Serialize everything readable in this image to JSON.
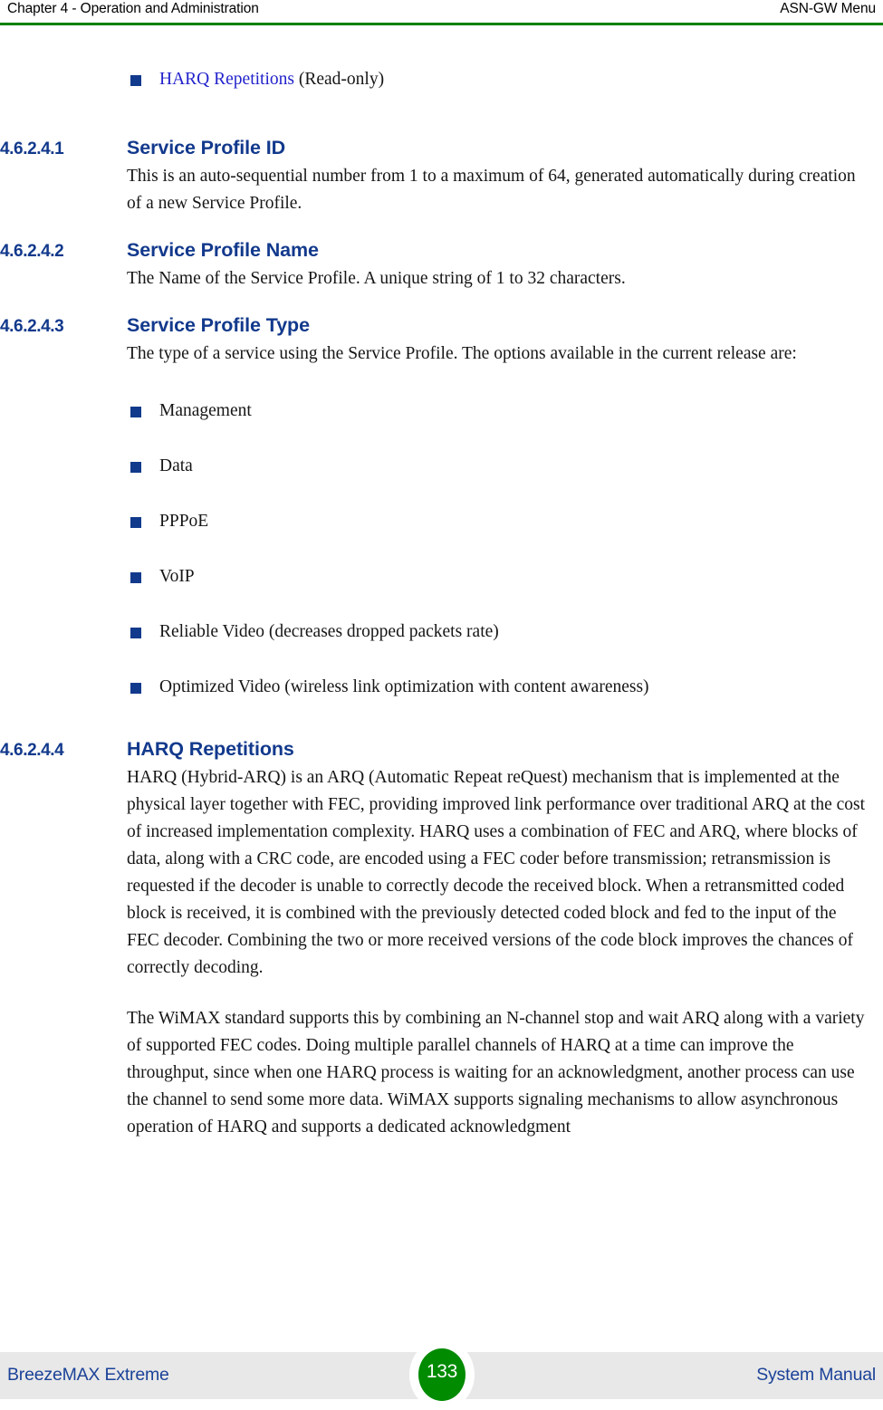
{
  "header": {
    "left": "Chapter 4 - Operation and Administration",
    "right": "ASN-GW Menu",
    "rule_color": "#008000"
  },
  "colors": {
    "heading_blue": "#12398c",
    "bullet_square": "#123a8c",
    "link_blue": "#2222cc",
    "footer_band": "#e8e8e8",
    "footer_text": "#1b4298",
    "badge_green": "#008b00"
  },
  "top_bullet": {
    "link_text": "HARQ Repetitions",
    "suffix_text": " (Read-only)"
  },
  "sections": [
    {
      "number": "4.6.2.4.1",
      "title": "Service Profile ID",
      "body": "This is an auto-sequential number from 1 to a maximum of 64, generated automatically during creation of a new Service Profile."
    },
    {
      "number": "4.6.2.4.2",
      "title": "Service Profile Name",
      "body": "The Name of the Service Profile. A unique string of 1 to 32 characters."
    },
    {
      "number": "4.6.2.4.3",
      "title": "Service Profile Type",
      "body": "The type of a service using the Service Profile. The options available in the current release are:"
    },
    {
      "number": "4.6.2.4.4",
      "title": "HARQ Repetitions",
      "body": "HARQ (Hybrid-ARQ) is an ARQ (Automatic Repeat reQuest) mechanism that is implemented at the physical layer together with FEC, providing improved link performance over traditional ARQ at the cost of increased implementation complexity. HARQ uses a combination of FEC and ARQ, where blocks of data, along with a CRC code, are encoded using a FEC coder before transmission; retransmission is requested if the decoder is unable to correctly decode the received block. When a retransmitted coded block is received, it is combined with the previously detected coded block and fed to the input of the FEC decoder. Combining the two or more received versions of the code block improves the chances of correctly decoding.",
      "body2": "The WiMAX standard supports this by combining an N-channel stop and wait ARQ along with a variety of supported FEC codes. Doing multiple parallel channels of HARQ at a time can improve the throughput, since when one HARQ process is waiting for an acknowledgment, another process can use the channel to send some more data. WiMAX supports signaling mechanisms to allow asynchronous operation of HARQ and supports a dedicated acknowledgment"
    }
  ],
  "service_profile_types": [
    "Management",
    "Data",
    "PPPoE",
    "VoIP",
    "Reliable Video (decreases dropped packets rate)",
    "Optimized Video (wireless link optimization with content awareness)"
  ],
  "footer": {
    "left": "BreezeMAX Extreme",
    "page_number": "133",
    "right": "System Manual"
  }
}
